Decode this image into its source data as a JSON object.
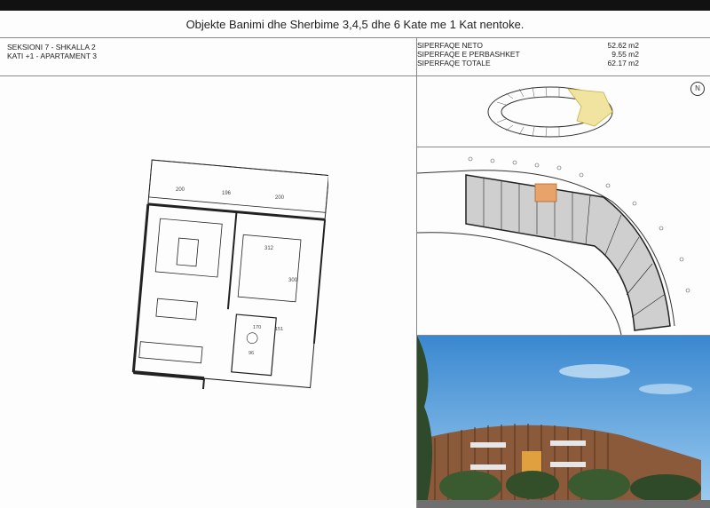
{
  "header": {
    "title": "Objekte Banimi dhe Sherbime 3,4,5 dhe 6 Kate me 1 Kat nentoke."
  },
  "unit": {
    "section": "SEKSIONI 7 - SHKALLA 2",
    "floor": "KATI +1 - APARTAMENT 3"
  },
  "areas": [
    {
      "label": "SIPERFAQE NETO",
      "value": "52.62 m2"
    },
    {
      "label": "SIPERFAQE E PERBASHKET",
      "value": "9.55 m2"
    },
    {
      "label": "SIPERFAQE TOTALE",
      "value": "62.17 m2"
    }
  ],
  "plan_dims": {
    "top_left": "200",
    "top_mid": "196",
    "top_right": "200",
    "bed_width": "312",
    "bed_height": "300",
    "bath_a": "170",
    "bath_b": "151",
    "bath_c": "96"
  },
  "north_label": "N",
  "colors": {
    "highlight_unit": "#e8a36a",
    "keyplan_highlight": "#f0e4a0",
    "sky": "#4a96d6",
    "facade": "#8a5a3a"
  }
}
